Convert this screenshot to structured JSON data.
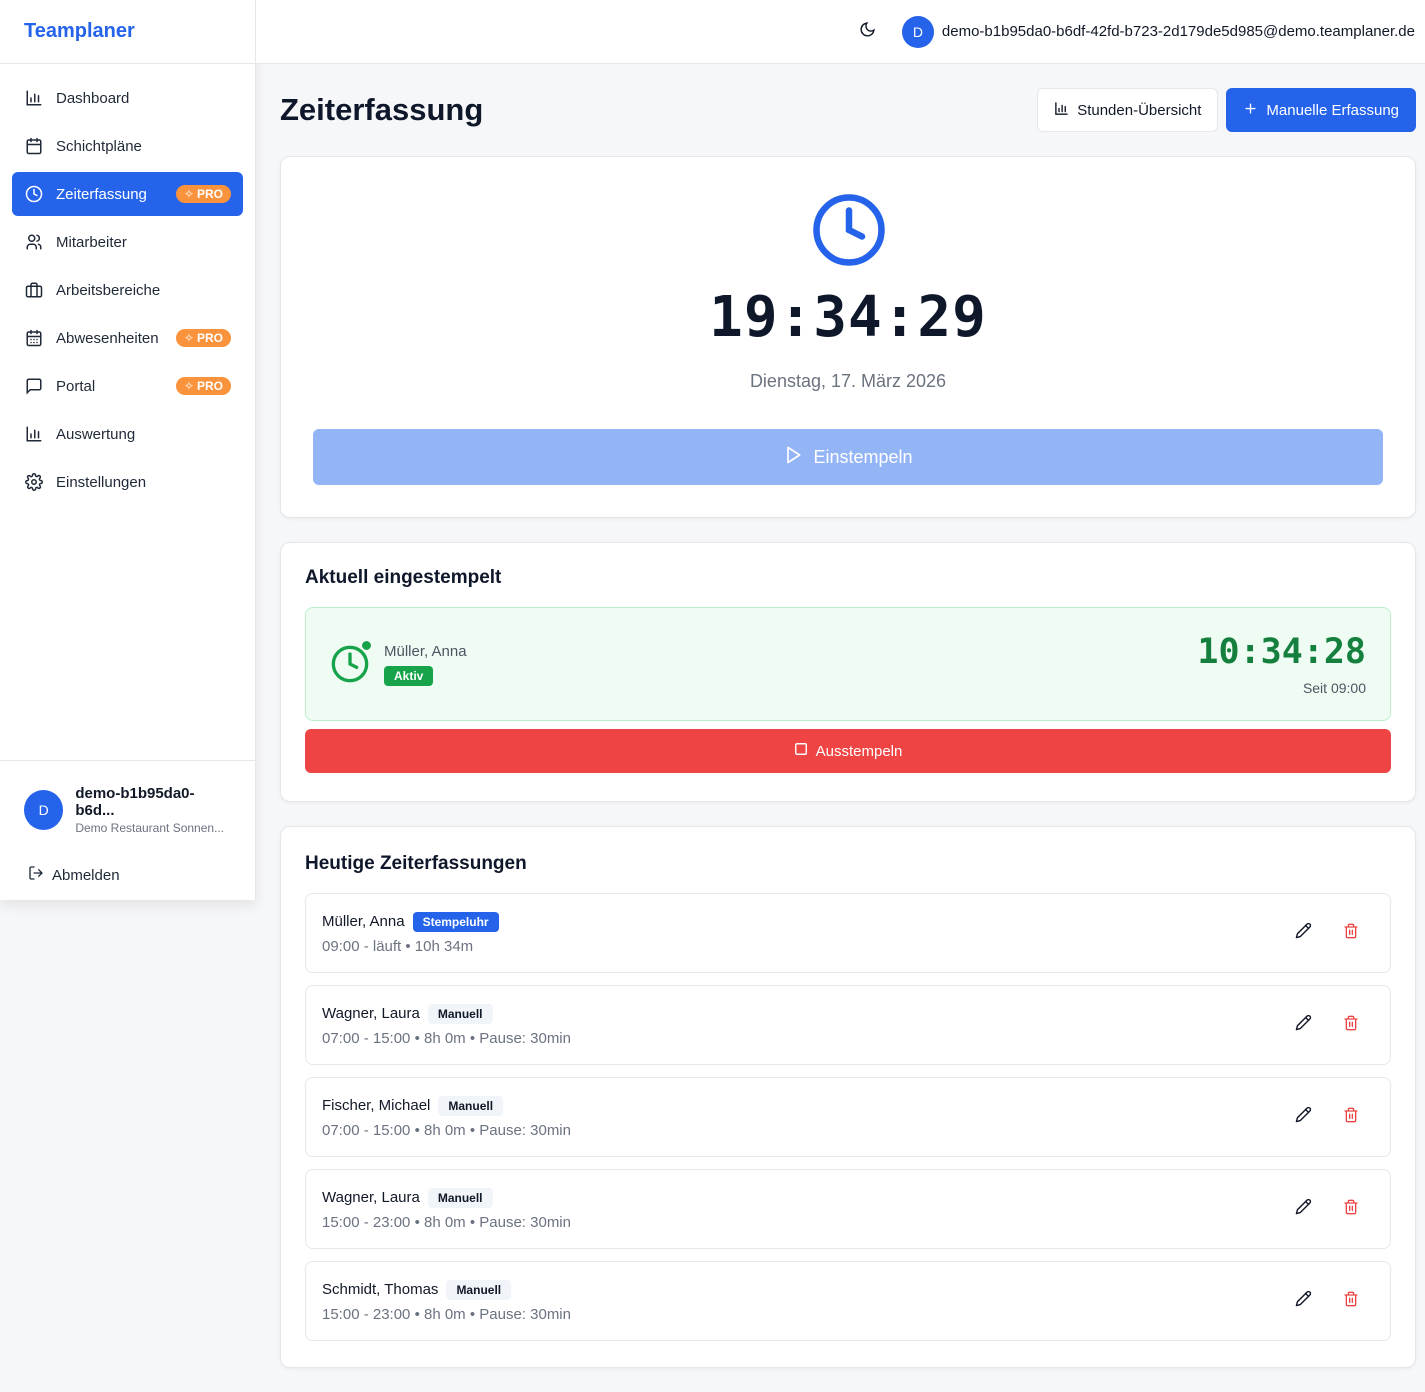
{
  "app": {
    "brand": "Teamplaner"
  },
  "sidebar": {
    "items": [
      {
        "label": "Dashboard",
        "icon": "bar-chart-icon",
        "pro": false,
        "active": false
      },
      {
        "label": "Schichtpläne",
        "icon": "calendar-icon",
        "pro": false,
        "active": false
      },
      {
        "label": "Zeiterfassung",
        "icon": "clock-icon",
        "pro": true,
        "active": true
      },
      {
        "label": "Mitarbeiter",
        "icon": "users-icon",
        "pro": false,
        "active": false
      },
      {
        "label": "Arbeitsbereiche",
        "icon": "briefcase-icon",
        "pro": false,
        "active": false
      },
      {
        "label": "Abwesenheiten",
        "icon": "calendar-days-icon",
        "pro": true,
        "active": false
      },
      {
        "label": "Portal",
        "icon": "message-square-icon",
        "pro": true,
        "active": false
      },
      {
        "label": "Auswertung",
        "icon": "bar-chart-icon",
        "pro": false,
        "active": false
      },
      {
        "label": "Einstellungen",
        "icon": "gear-icon",
        "pro": false,
        "active": false
      }
    ],
    "pro_label": "PRO",
    "user": {
      "initial": "D",
      "name": "demo-b1b95da0-b6d...",
      "org": "Demo Restaurant Sonnen..."
    },
    "logout_label": "Abmelden"
  },
  "topbar": {
    "initial": "D",
    "email": "demo-b1b95da0-b6df-42fd-b723-2d179de5d985@demo.teamplaner.de"
  },
  "page": {
    "title": "Zeiterfassung",
    "hours_overview_label": "Stunden-Übersicht",
    "manual_entry_label": "Manuelle Erfassung"
  },
  "clock": {
    "time": "19:34:29",
    "date": "Dienstag, 17. März 2026",
    "stamp_in_label": "Einstempeln"
  },
  "active": {
    "title": "Aktuell eingestempelt",
    "name": "Müller, Anna",
    "status": "Aktiv",
    "timer": "10:34:28",
    "since": "Seit 09:00",
    "stamp_out_label": "Ausstempeln"
  },
  "entries": {
    "title": "Heutige Zeiterfassungen",
    "items": [
      {
        "name": "Müller, Anna",
        "tag": "Stempeluhr",
        "tag_style": "blue",
        "meta": "09:00 - läuft • 10h 34m"
      },
      {
        "name": "Wagner, Laura",
        "tag": "Manuell",
        "tag_style": "gray",
        "meta": "07:00 - 15:00 • 8h 0m • Pause: 30min"
      },
      {
        "name": "Fischer, Michael",
        "tag": "Manuell",
        "tag_style": "gray",
        "meta": "07:00 - 15:00 • 8h 0m • Pause: 30min"
      },
      {
        "name": "Wagner, Laura",
        "tag": "Manuell",
        "tag_style": "gray",
        "meta": "15:00 - 23:00 • 8h 0m • Pause: 30min"
      },
      {
        "name": "Schmidt, Thomas",
        "tag": "Manuell",
        "tag_style": "gray",
        "meta": "15:00 - 23:00 • 8h 0m • Pause: 30min"
      }
    ]
  },
  "colors": {
    "primary": "#2563eb",
    "pro": "#fb923c",
    "success": "#16a34a",
    "danger": "#ef4444"
  }
}
